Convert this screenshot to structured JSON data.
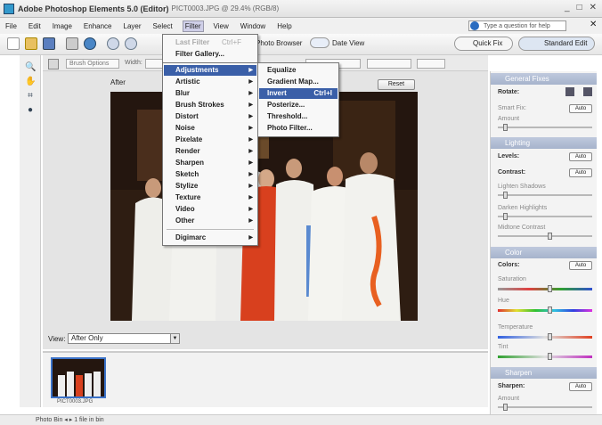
{
  "window": {
    "title": "Adobe Photoshop Elements 5.0 (Editor)",
    "doc": "PICT0003.JPG @ 29.4% (RGB/8)",
    "buttons": [
      "_",
      "□",
      "✕"
    ]
  },
  "menubar": {
    "items": [
      "File",
      "Edit",
      "Image",
      "Enhance",
      "Layer",
      "Select",
      "Filter",
      "View",
      "Window",
      "Help"
    ],
    "active": "Filter",
    "help_placeholder": "Type a question for help",
    "help_close": "✕"
  },
  "toolbar": {
    "photo_browser": "Photo Browser",
    "date_view": "Date View",
    "quick_fix": "Quick Fix",
    "standard_edit": "Standard Edit"
  },
  "options": {
    "brush_options": "Brush Options",
    "width_label": "Width:"
  },
  "filter_menu": {
    "last_filter": "Last Filter",
    "last_filter_shortcut": "Ctrl+F",
    "filter_gallery": "Filter Gallery..."
  },
  "filter_submenu": [
    "Adjustments",
    "Artistic",
    "Blur",
    "Brush Strokes",
    "Distort",
    "Noise",
    "Pixelate",
    "Render",
    "Sharpen",
    "Sketch",
    "Stylize",
    "Texture",
    "Video",
    "Other",
    "Digimarc"
  ],
  "adjustments_menu": {
    "items": [
      "Equalize",
      "Gradient Map...",
      "Invert",
      "Posterize...",
      "Threshold...",
      "Photo Filter..."
    ],
    "invert_shortcut": "Ctrl+I",
    "highlighted": "Invert"
  },
  "canvas": {
    "after_label": "After",
    "reset_label": "Reset"
  },
  "view": {
    "label": "View:",
    "value": "After Only"
  },
  "bin": {
    "thumb_label": "PICT0003.JPG"
  },
  "status": {
    "text": "Photo Bin  ◂  ▸  1 file in bin"
  },
  "palette": {
    "general_fixes": "General Fixes",
    "rotate": "Rotate:",
    "smart_fix": "Smart Fix:",
    "amount": "Amount",
    "lighting": "Lighting",
    "levels": "Levels:",
    "contrast": "Contrast:",
    "lighten_shadows": "Lighten Shadows",
    "darken_highlights": "Darken Highlights",
    "midtone_contrast": "Midtone Contrast",
    "color": "Color",
    "colors": "Colors:",
    "saturation": "Saturation",
    "hue": "Hue",
    "temperature": "Temperature",
    "tint": "Tint",
    "sharpen_section": "Sharpen",
    "sharpen": "Sharpen:",
    "auto": "Auto",
    "sharpen_amount": "Amount"
  },
  "colors": {
    "menu_highlight": "#3a5fa8",
    "palette_header": "#a6b3cc",
    "thumb_border": "#3b72c8"
  }
}
